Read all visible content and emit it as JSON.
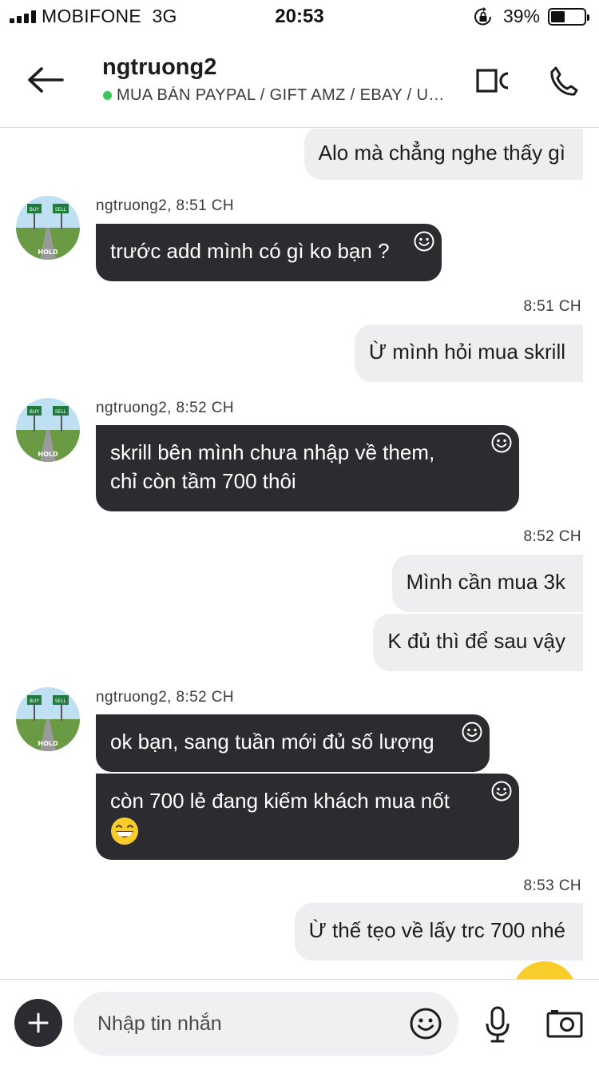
{
  "status_bar": {
    "carrier": "MOBIFONE",
    "network": "3G",
    "time": "20:53",
    "battery": "39%",
    "battery_level": 0.39
  },
  "header": {
    "title": "ngtruong2",
    "subtitle": "MUA BÁN PAYPAL / GIFT AMZ / EBAY / U…",
    "presence_color": "#3cc55c"
  },
  "messages": [
    {
      "direction": "outgoing",
      "text": "Alo mà chẳng nghe thấy gì"
    },
    {
      "direction": "incoming",
      "sender": "ngtruong2, 8:51 CH",
      "text": "trước add mình có gì ko bạn ?"
    },
    {
      "direction": "outgoing",
      "time": "8:51 CH",
      "text": "Ừ mình hỏi mua skrill"
    },
    {
      "direction": "incoming",
      "sender": "ngtruong2, 8:52 CH",
      "lines": [
        "skrill bên mình chưa nhập về them,",
        "chỉ còn tầm 700 thôi"
      ]
    },
    {
      "direction": "outgoing",
      "time": "8:52 CH",
      "text": "Mình cần mua 3k"
    },
    {
      "direction": "outgoing",
      "text": "K đủ thì để sau vậy"
    },
    {
      "direction": "incoming",
      "sender": "ngtruong2, 8:52 CH",
      "text": "ok bạn, sang tuần mới đủ số lượng"
    },
    {
      "direction": "incoming",
      "text": "còn 700 lẻ đang kiếm khách mua nốt",
      "emoji": "grinning-face"
    },
    {
      "direction": "outgoing",
      "time": "8:53 CH",
      "text": "Ừ thế tẹo về lấy trc 700 nhé"
    }
  ],
  "composer": {
    "placeholder": "Nhập tin nhắn"
  },
  "colors": {
    "incoming_bubble": "#2b2b30",
    "outgoing_bubble": "#eeeef1",
    "emoji_yellow": "#f8cc2b"
  }
}
